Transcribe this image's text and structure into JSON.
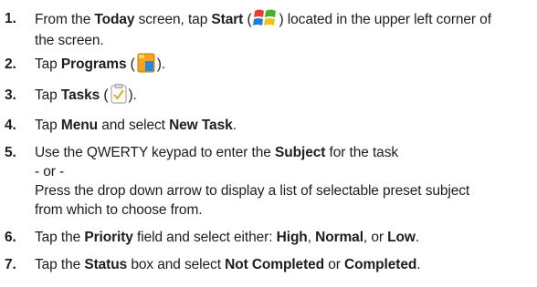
{
  "steps": [
    {
      "number": "1.",
      "parts": {
        "a": "From the ",
        "b": "Today",
        "c": " screen, tap ",
        "d": "Start",
        "e": " (",
        "f": ") located in the upper left corner of",
        "g": "the screen."
      },
      "icon": "windows-start-icon"
    },
    {
      "number": "2.",
      "parts": {
        "a": "Tap ",
        "b": "Programs",
        "c": " (",
        "d": ")."
      },
      "icon": "programs-folder-icon"
    },
    {
      "number": "3.",
      "parts": {
        "a": "Tap ",
        "b": "Tasks",
        "c": " (",
        "d": ")."
      },
      "icon": "tasks-clipboard-icon"
    },
    {
      "number": "4.",
      "parts": {
        "a": "Tap ",
        "b": "Menu",
        "c": " and select ",
        "d": "New Task",
        "e": "."
      }
    },
    {
      "number": "5.",
      "parts": {
        "a": "Use the QWERTY keypad to enter the ",
        "b": "Subject",
        "c": " for the task",
        "d": "- or -",
        "e": "Press the drop down arrow to display a list of selectable preset subject",
        "f": "from which to choose from."
      }
    },
    {
      "number": "6.",
      "parts": {
        "a": "Tap the ",
        "b": "Priority",
        "c": " field and select either: ",
        "d": "High",
        "e": ", ",
        "f": "Normal",
        "g": ", or ",
        "h": "Low",
        "i": "."
      }
    },
    {
      "number": "7.",
      "parts": {
        "a": "Tap the ",
        "b": "Status",
        "c": " box and select ",
        "d": "Not Completed",
        "e": " or ",
        "f": "Completed",
        "g": "."
      }
    }
  ]
}
